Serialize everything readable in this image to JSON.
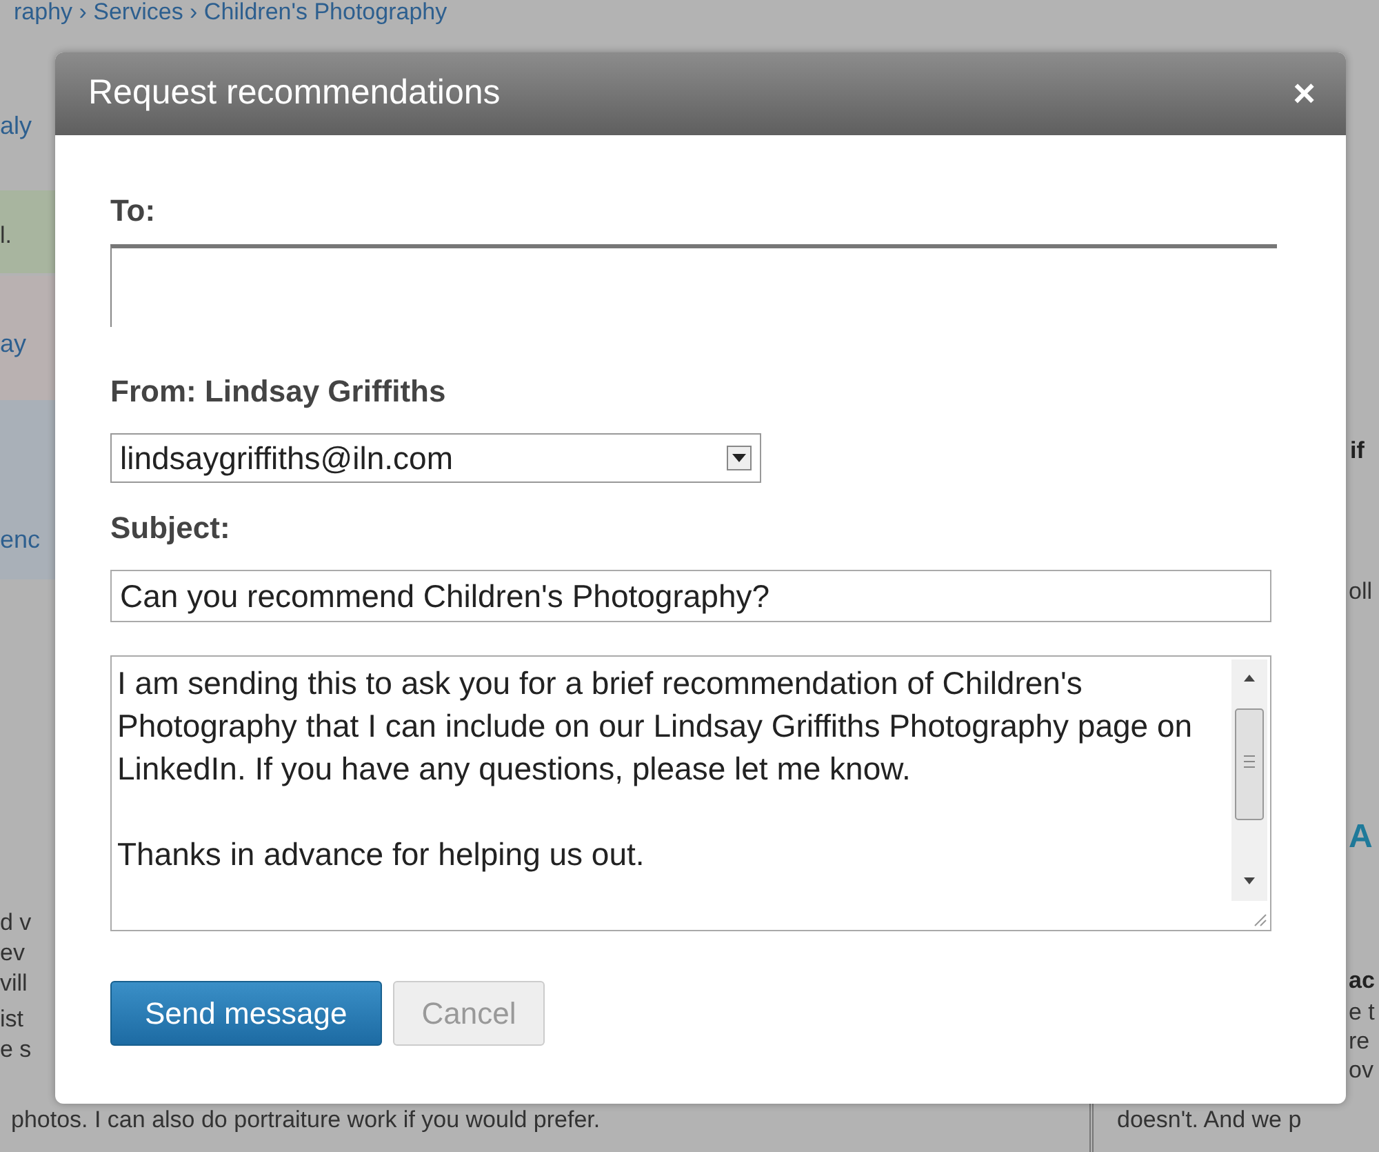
{
  "background_page": {
    "fragments": [
      {
        "text": "raphy › Services › Children's Photography",
        "kind": "link"
      },
      {
        "text": "aly",
        "kind": "link"
      },
      {
        "text": "l.",
        "kind": "text"
      },
      {
        "text": "ay",
        "kind": "link"
      },
      {
        "text": "enc",
        "kind": "link"
      },
      {
        "text": "d v",
        "kind": "text"
      },
      {
        "text": "ev",
        "kind": "text"
      },
      {
        "text": "vill",
        "kind": "text"
      },
      {
        "text": "ist",
        "kind": "text"
      },
      {
        "text": "e s",
        "kind": "text"
      },
      {
        "text": "photos.  I can also do portraiture work if you would prefer.",
        "kind": "text"
      },
      {
        "text": "if",
        "kind": "heading"
      },
      {
        "text": "oll",
        "kind": "text"
      },
      {
        "text": "A",
        "kind": "logo"
      },
      {
        "text": "ac",
        "kind": "heading"
      },
      {
        "text": "e t",
        "kind": "text"
      },
      {
        "text": "re",
        "kind": "text"
      },
      {
        "text": "ov",
        "kind": "text"
      },
      {
        "text": "doesn't. And we p",
        "kind": "text"
      }
    ]
  },
  "dialog": {
    "title": "Request recommendations",
    "close": "×",
    "to_label": "To:",
    "from_label": "From: Lindsay Griffiths",
    "from_select": {
      "value": "lindsaygriffiths@iln.com"
    },
    "subject_label": "Subject:",
    "subject_value": "Can you recommend Children's Photography?",
    "message": "I am sending this to ask you for a brief recommendation of Children's Photography that I can include on our Lindsay Griffiths Photography page on LinkedIn. If you have any questions, please let me know.\n\nThanks in advance for helping us out.",
    "buttons": [
      {
        "label": "Send message",
        "kind": "primary"
      },
      {
        "label": "Cancel",
        "kind": "secondary"
      }
    ]
  }
}
